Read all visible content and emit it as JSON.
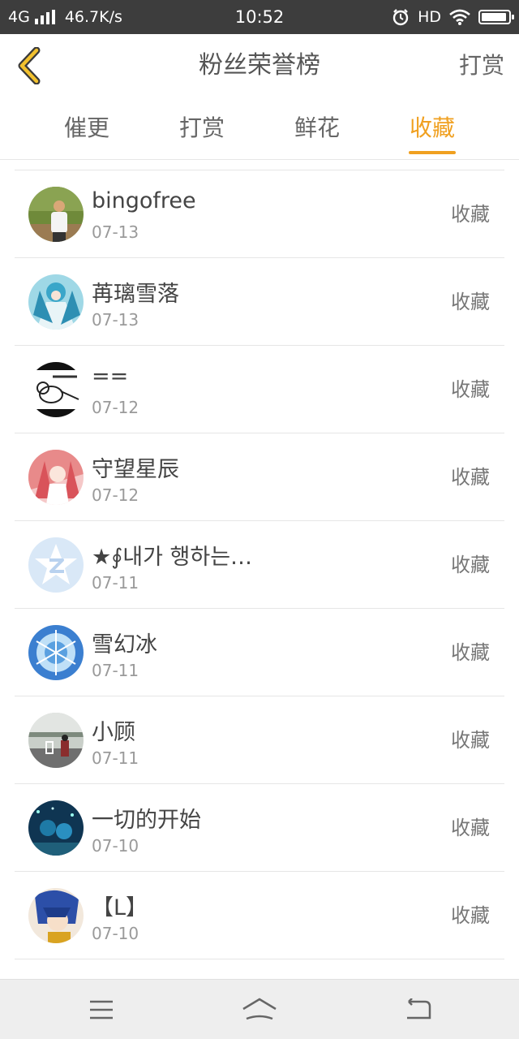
{
  "status_bar": {
    "network": "4G",
    "speed": "46.7K/s",
    "time": "10:52",
    "hd": "HD",
    "battery_level": 0.95
  },
  "header": {
    "title": "粉丝荣誉榜",
    "action_label": "打赏"
  },
  "tabs": [
    {
      "label": "催更"
    },
    {
      "label": "打赏"
    },
    {
      "label": "鲜花"
    },
    {
      "label": "收藏",
      "active": true
    }
  ],
  "colors": {
    "accent": "#f0a020",
    "status_bar": "#3d3d3d"
  },
  "list": {
    "items": [
      {
        "name": "bingofree",
        "date": "07-13",
        "action": "收藏",
        "avatar": "photo-man-icon"
      },
      {
        "name": "苒璃雪落",
        "date": "07-13",
        "action": "收藏",
        "avatar": "anime-blue-icon"
      },
      {
        "name": "==",
        "date": "07-12",
        "action": "收藏",
        "avatar": "sketch-icon"
      },
      {
        "name": "守望星辰",
        "date": "07-12",
        "action": "收藏",
        "avatar": "anime-pink-icon"
      },
      {
        "name": "★∮내가 행하는…",
        "date": "07-11",
        "action": "收藏",
        "avatar": "qq-default-icon"
      },
      {
        "name": "雪幻冰",
        "date": "07-11",
        "action": "收藏",
        "avatar": "ice-blue-icon"
      },
      {
        "name": "小顾",
        "date": "07-11",
        "action": "收藏",
        "avatar": "lake-photo-icon"
      },
      {
        "name": "一切的开始",
        "date": "07-10",
        "action": "收藏",
        "avatar": "anime-night-icon"
      },
      {
        "name": "【L】",
        "date": "07-10",
        "action": "收藏",
        "avatar": "anime-boy-icon"
      }
    ]
  }
}
